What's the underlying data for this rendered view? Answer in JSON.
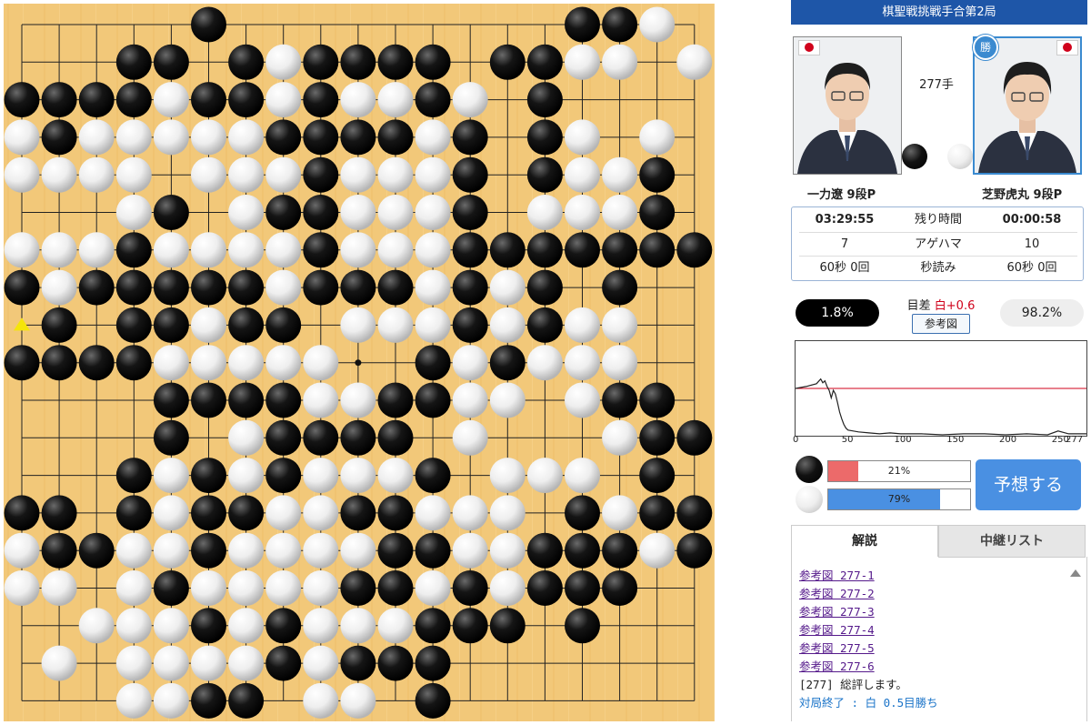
{
  "game_title": "棋聖戦挑戦手合第2局",
  "move_label": "277手",
  "win_badge": "勝",
  "players": {
    "black": {
      "name": "一力遼 9段P",
      "time_left": "03:29:55",
      "captures": "7",
      "byoyomi": "60秒 0回",
      "win_rate": "1.8%",
      "photo_icon": "player-photo"
    },
    "white": {
      "name": "芝野虎丸 9段P",
      "time_left": "00:00:58",
      "captures": "10",
      "byoyomi": "60秒 0回",
      "win_rate": "98.2%",
      "photo_icon": "player-photo"
    }
  },
  "labels": {
    "time": "残り時間",
    "captures": "アゲハマ",
    "byoyomi": "秒読み"
  },
  "score_diff": {
    "label": "目差",
    "value": "白+0.6"
  },
  "ref_button": "参考図",
  "graph": {
    "x_ticks": [
      "0",
      "50",
      "100",
      "150",
      "200",
      "250",
      "277"
    ]
  },
  "prediction": {
    "black_pct": 21,
    "black_label": "21%",
    "white_pct": 79,
    "white_label": "79%",
    "button": "予想する"
  },
  "tabs": {
    "commentary": "解説",
    "relay": "中継リスト"
  },
  "comments": {
    "ref1": "参考図 277-1",
    "ref2": "参考図 277-2",
    "ref3": "参考図 277-3",
    "ref4": "参考図 277-4",
    "ref5": "参考図 277-5",
    "ref6": "参考図 277-6",
    "summary": "[277] 総評します。",
    "result": "対局終了 : 白 0.5目勝ち"
  },
  "chart_data": {
    "type": "line",
    "title": "",
    "xlabel": "",
    "ylabel": "",
    "xlim": [
      0,
      277
    ],
    "ylim": [
      0,
      100
    ],
    "reference_line": 50,
    "series": [
      {
        "x": [
          0,
          10,
          20,
          24,
          26,
          28,
          30,
          32,
          34,
          36,
          38,
          40,
          42,
          44,
          46,
          48,
          50,
          55,
          60,
          70,
          80,
          90,
          100,
          120,
          140,
          160,
          180,
          200,
          220,
          240,
          250,
          260,
          277
        ],
        "y": [
          50,
          52,
          55,
          60,
          56,
          58,
          52,
          48,
          40,
          48,
          44,
          35,
          25,
          18,
          12,
          8,
          6,
          5,
          4,
          3,
          2,
          3,
          2,
          2,
          1,
          2,
          2,
          1,
          2,
          1,
          5,
          2,
          2
        ]
      }
    ]
  },
  "board": {
    "size": 19,
    "last_move": [
      8,
      0
    ],
    "stones": [
      ".....B.........BBW.",
      "...BB.BWBBBB.BBWW.W",
      "BBBBWBBWBWWBW.B....",
      "WBWWWWWBBBBWB.BW.W.",
      "WWWW.WWWBWWWB.BWWB.",
      "...WB.WBBWWWB.WWWB.",
      "WWWBWWWWBWWWBBBBBBB",
      "BWBBBBBWBBBWBWB.B..",
      ".B.BBWBB.WWWBWBWW..",
      "BBBBWWWWW..BWBWWW..",
      "....BBBBWWBBWW.WBB.",
      "....B.WBBBB.W...WBB",
      "...BWBWBWWWB.WWW.B.",
      "BB.BWBBWWBBWWW.BWBB",
      "WBBWWBWWWWBBWWBBBWB",
      "WW.WBWWWWBBWBWBBB..",
      "..WWWBWBWWWBBB.B...",
      ".W.WWWWBWBBB.......",
      "...WWBB.WW.B......."
    ]
  },
  "colors": {
    "accent": "#1e56a8",
    "board": "#f2c879",
    "red": "#d0021b",
    "blue": "#4a90e2"
  }
}
